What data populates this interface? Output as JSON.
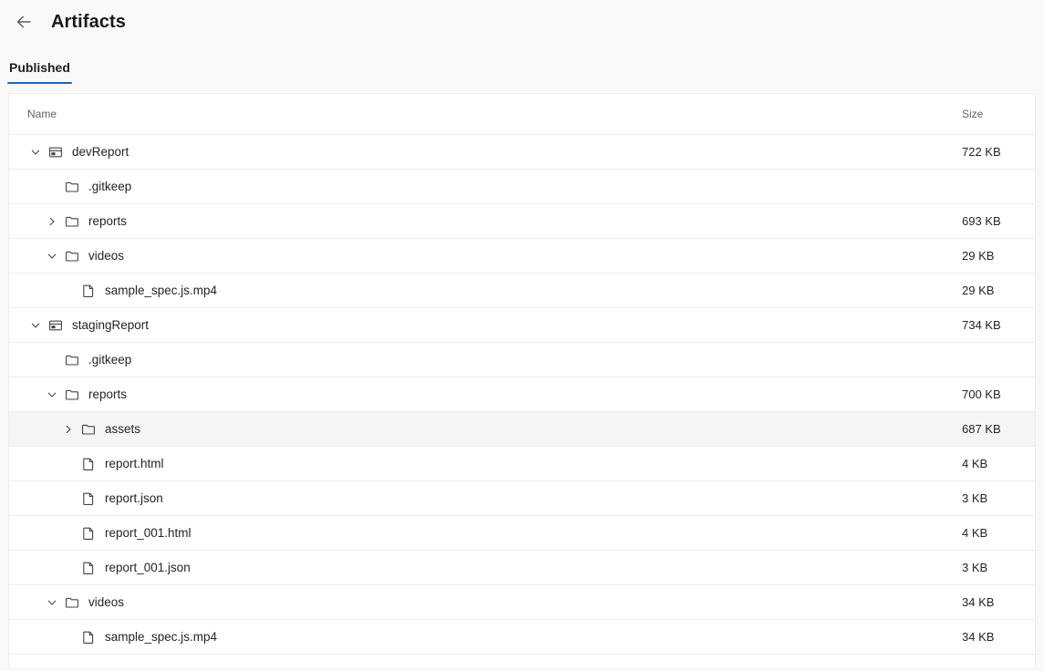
{
  "header": {
    "back_icon": "arrow-left-icon",
    "title": "Artifacts"
  },
  "tabs": [
    {
      "label": "Published",
      "active": true
    }
  ],
  "table": {
    "columns": {
      "name": "Name",
      "size": "Size"
    },
    "rows": [
      {
        "name": "devReport",
        "size": "722 KB",
        "depth": 0,
        "icon": "artifact-icon",
        "chevron": "expanded",
        "highlight": false
      },
      {
        "name": ".gitkeep",
        "size": "",
        "depth": 1,
        "icon": "folder-icon",
        "chevron": "none",
        "highlight": false
      },
      {
        "name": "reports",
        "size": "693 KB",
        "depth": 1,
        "icon": "folder-icon",
        "chevron": "collapsed",
        "highlight": false
      },
      {
        "name": "videos",
        "size": "29 KB",
        "depth": 1,
        "icon": "folder-icon",
        "chevron": "expanded",
        "highlight": false
      },
      {
        "name": "sample_spec.js.mp4",
        "size": "29 KB",
        "depth": 2,
        "icon": "file-icon",
        "chevron": "none",
        "highlight": false
      },
      {
        "name": "stagingReport",
        "size": "734 KB",
        "depth": 0,
        "icon": "artifact-icon",
        "chevron": "expanded",
        "highlight": false
      },
      {
        "name": ".gitkeep",
        "size": "",
        "depth": 1,
        "icon": "folder-icon",
        "chevron": "none",
        "highlight": false
      },
      {
        "name": "reports",
        "size": "700 KB",
        "depth": 1,
        "icon": "folder-icon",
        "chevron": "expanded",
        "highlight": false
      },
      {
        "name": "assets",
        "size": "687 KB",
        "depth": 2,
        "icon": "folder-icon",
        "chevron": "collapsed",
        "highlight": true
      },
      {
        "name": "report.html",
        "size": "4 KB",
        "depth": 2,
        "icon": "file-icon",
        "chevron": "none",
        "highlight": false
      },
      {
        "name": "report.json",
        "size": "3 KB",
        "depth": 2,
        "icon": "file-icon",
        "chevron": "none",
        "highlight": false
      },
      {
        "name": "report_001.html",
        "size": "4 KB",
        "depth": 2,
        "icon": "file-icon",
        "chevron": "none",
        "highlight": false
      },
      {
        "name": "report_001.json",
        "size": "3 KB",
        "depth": 2,
        "icon": "file-icon",
        "chevron": "none",
        "highlight": false
      },
      {
        "name": "videos",
        "size": "34 KB",
        "depth": 1,
        "icon": "folder-icon",
        "chevron": "expanded",
        "highlight": false
      },
      {
        "name": "sample_spec.js.mp4",
        "size": "34 KB",
        "depth": 2,
        "icon": "file-icon",
        "chevron": "none",
        "highlight": false
      }
    ]
  },
  "colors": {
    "accent": "#0f6cbd",
    "icon": "#424242",
    "text": "#242424",
    "muted": "#616161",
    "row_border": "#ededed",
    "highlight": "#f5f5f5",
    "page_bg": "#faf9f8"
  }
}
